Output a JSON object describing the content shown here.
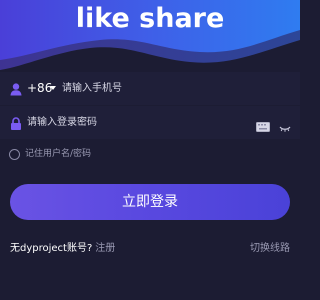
{
  "brand": {
    "title": "like share"
  },
  "phone": {
    "country_code": "+86",
    "placeholder": "请输入手机号"
  },
  "password": {
    "placeholder": "请输入登录密码"
  },
  "remember": {
    "label": "记住用户名/密码"
  },
  "login_button": {
    "label": "立即登录"
  },
  "register": {
    "question": "无dyproject账号?",
    "link": "注册"
  },
  "switch_route": {
    "label": "切换线路"
  },
  "colors": {
    "background": "#1c1c33",
    "accent": "#5a49e0",
    "icon_purple": "#7a5cf2"
  }
}
